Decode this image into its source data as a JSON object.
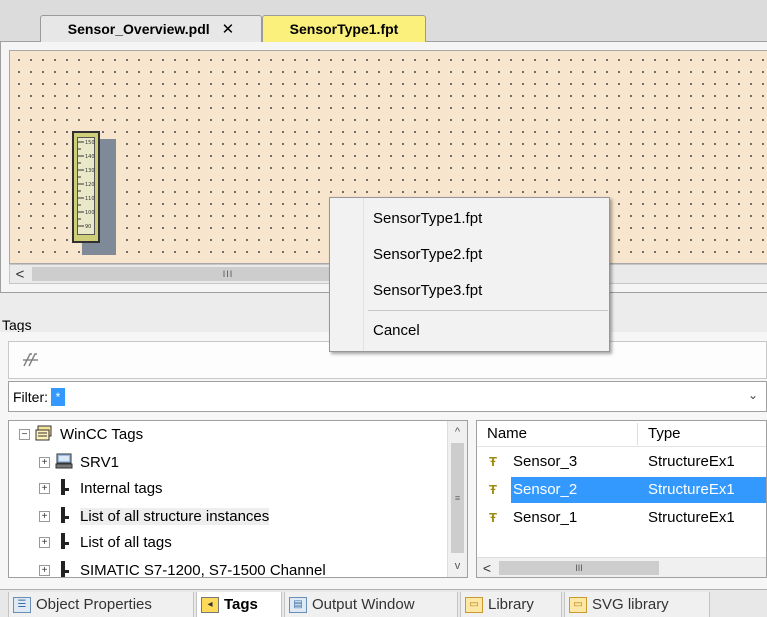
{
  "document_tabs": [
    {
      "label": "Sensor_Overview.pdl",
      "close": "✕"
    },
    {
      "label": "SensorType1.fpt"
    }
  ],
  "canvas": {
    "gauge_labels": [
      "150",
      "140",
      "130",
      "120",
      "110",
      "100",
      "90"
    ]
  },
  "scrollbar": {
    "left_arrow": "<",
    "thumb_grip": "III"
  },
  "tags_pane": {
    "title": "Tags",
    "toolbar_icon": "tag-filter-icon",
    "filter_label": "Filter:",
    "filter_value": "*",
    "filter_dropdown": "⌄",
    "tree": {
      "items": [
        {
          "label": "WinCC Tags",
          "expander": "−",
          "icon": "🗇"
        },
        {
          "label": "SRV1",
          "expander": "+",
          "icon": "🖳"
        },
        {
          "label": "Internal tags",
          "expander": "+",
          "icon": "▮"
        },
        {
          "label": "List of all structure instances",
          "expander": "+",
          "icon": "▮"
        },
        {
          "label": "List of all tags",
          "expander": "+",
          "icon": "▮"
        },
        {
          "label": "SIMATIC S7-1200, S7-1500 Channel",
          "expander": "+",
          "icon": "▮"
        }
      ],
      "scroll_up": "^",
      "scroll_down": "v",
      "scroll_thumb": "≡"
    },
    "list": {
      "columns": {
        "name": "Name",
        "type": "Type"
      },
      "rows": [
        {
          "name": "Sensor_3",
          "type": "StructureEx1",
          "selected": false
        },
        {
          "name": "Sensor_2",
          "type": "StructureEx1",
          "selected": true
        },
        {
          "name": "Sensor_1",
          "type": "StructureEx1",
          "selected": false
        }
      ],
      "row_icon": "Ŧ",
      "scroll_left": "<",
      "scroll_thumb": "III"
    }
  },
  "bottom_tabs": [
    {
      "label": "Object Properties",
      "icon": "properties-icon",
      "active": false
    },
    {
      "label": "Tags",
      "icon": "tags-icon",
      "active": true
    },
    {
      "label": "Output Window",
      "icon": "output-window-icon",
      "active": false
    },
    {
      "label": "Library",
      "icon": "library-icon",
      "active": false
    },
    {
      "label": "SVG library",
      "icon": "svg-library-icon",
      "active": false
    }
  ],
  "context_menu": {
    "items": [
      "SensorType1.fpt",
      "SensorType2.fpt",
      "SensorType3.fpt"
    ],
    "cancel": "Cancel"
  }
}
